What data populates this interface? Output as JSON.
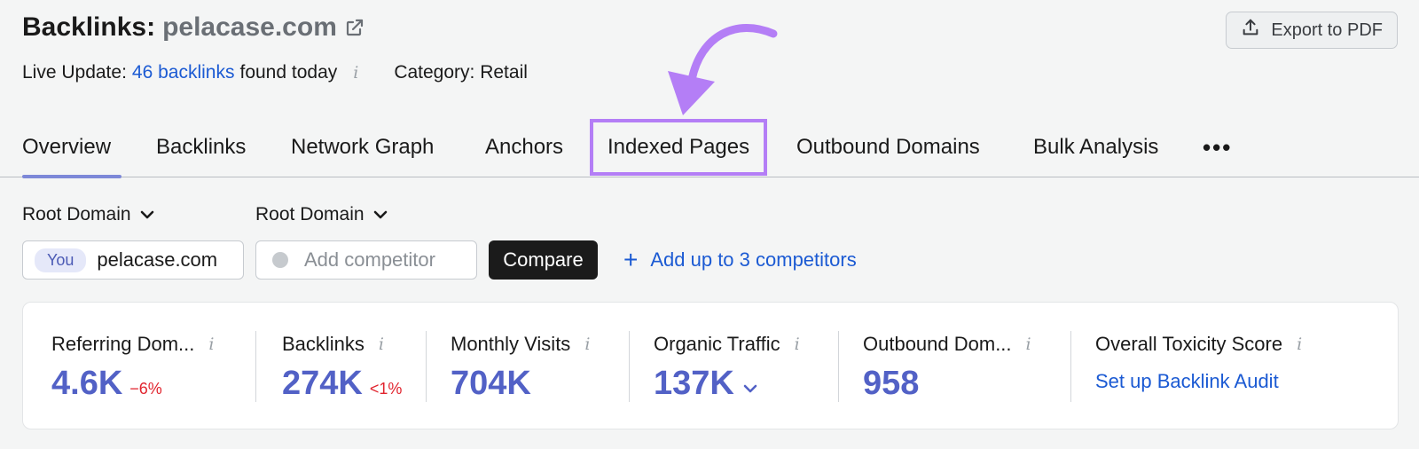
{
  "header": {
    "title_prefix": "Backlinks:",
    "domain": "pelacase.com",
    "live_update_label": "Live Update:",
    "live_update_link": "46 backlinks",
    "live_update_suffix": "found today",
    "category": "Category: Retail",
    "export_label": "Export to PDF"
  },
  "tabs": [
    {
      "label": "Overview",
      "active": true
    },
    {
      "label": "Backlinks"
    },
    {
      "label": "Network Graph"
    },
    {
      "label": "Anchors"
    },
    {
      "label": "Indexed Pages",
      "highlighted": true
    },
    {
      "label": "Outbound Domains"
    },
    {
      "label": "Bulk Analysis"
    }
  ],
  "more_label": "•••",
  "filters": {
    "root_domain_1": "Root Domain",
    "root_domain_2": "Root Domain",
    "you_badge": "You",
    "you_domain": "pelacase.com",
    "competitor_placeholder": "Add competitor",
    "compare_label": "Compare",
    "add_competitors_label": "Add up to 3 competitors"
  },
  "metrics": [
    {
      "label": "Referring Dom...",
      "value": "4.6K",
      "delta": "−6%"
    },
    {
      "label": "Backlinks",
      "value": "274K",
      "delta": "<1%"
    },
    {
      "label": "Monthly Visits",
      "value": "704K"
    },
    {
      "label": "Organic Traffic",
      "value": "137K"
    },
    {
      "label": "Outbound Dom...",
      "value": "958"
    },
    {
      "label": "Overall Toxicity Score",
      "link": "Set up Backlink Audit"
    }
  ],
  "colors": {
    "accent": "#5261c6",
    "link": "#1b5ad3",
    "highlight": "#b47ef6",
    "negative": "#e1242e"
  }
}
